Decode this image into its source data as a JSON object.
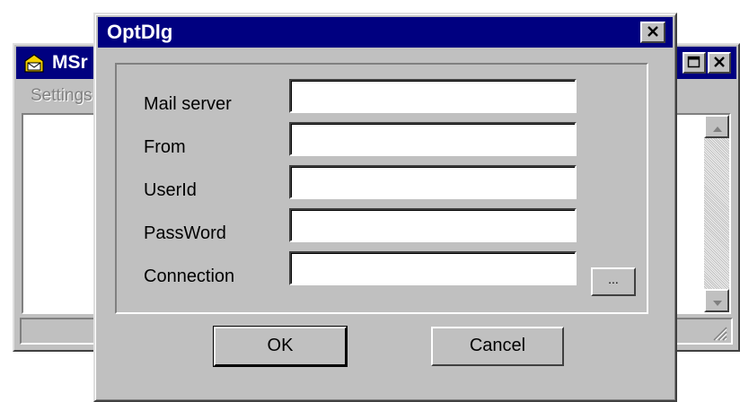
{
  "main_window": {
    "title": "MSr",
    "menu": {
      "settings_label": "Settings"
    },
    "icons": {
      "app": "envelope-icon",
      "maximize": "maximize-icon",
      "close": "close-icon",
      "scroll_up": "arrow-up-icon",
      "scroll_down": "arrow-down-icon",
      "size_grip": "size-grip-icon"
    }
  },
  "dialog": {
    "title": "OptDlg",
    "close_icon": "close-icon",
    "fields": [
      {
        "label": "Mail server",
        "value": ""
      },
      {
        "label": "From",
        "value": ""
      },
      {
        "label": "UserId",
        "value": ""
      },
      {
        "label": "PassWord",
        "value": ""
      },
      {
        "label": "Connection",
        "value": ""
      }
    ],
    "browse_label": "...",
    "ok_label": "OK",
    "cancel_label": "Cancel"
  },
  "colors": {
    "titlebar": "#000080",
    "face": "#c0c0c0",
    "title_text": "#ffffff",
    "disabled_text": "#808080",
    "field_bg": "#ffffff"
  }
}
